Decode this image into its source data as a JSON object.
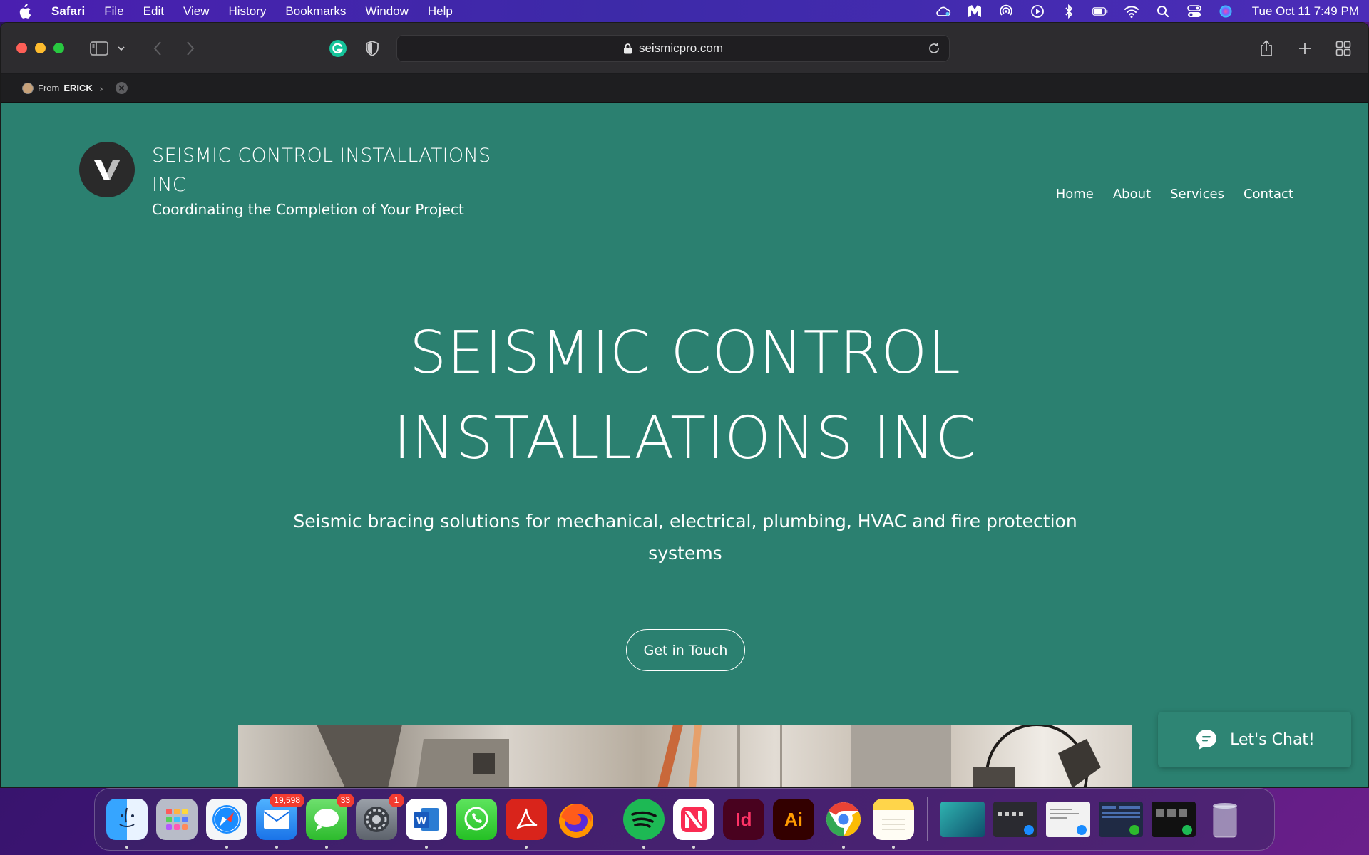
{
  "menubar": {
    "app_name": "Safari",
    "items": [
      "File",
      "Edit",
      "View",
      "History",
      "Bookmarks",
      "Window",
      "Help"
    ],
    "clock": "Tue Oct 11  7:49 PM"
  },
  "browser": {
    "url": "seismicpro.com",
    "shared_from_label": "From",
    "shared_from_name": "ERICK"
  },
  "site": {
    "name": "SEISMIC CONTROL INSTALLATIONS INC",
    "tagline": "Coordinating the Completion of Your Project",
    "nav": [
      "Home",
      "About",
      "Services",
      "Contact"
    ],
    "hero_title_line1": "SEISMIC CONTROL",
    "hero_title_line2": "INSTALLATIONS INC",
    "hero_subtitle": "Seismic bracing solutions for mechanical, electrical, plumbing, HVAC and fire protection systems",
    "cta_label": "Get in Touch",
    "chat_label": "Let's Chat!",
    "colors": {
      "page_background": "#2b8070",
      "text": "#ffffff",
      "logo_circle": "#2a2a2a"
    }
  },
  "dock": {
    "mail_badge": "19,598",
    "messages_badge": "33",
    "settings_badge": "1",
    "indesign_label": "Id",
    "illustrator_label": "Ai",
    "word_label": "W"
  }
}
